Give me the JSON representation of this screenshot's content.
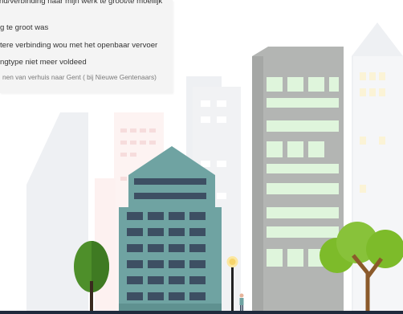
{
  "survey": {
    "options": [
      "nd/verbinding naar mijn werk te groot/te moeilijk",
      "g te groot was",
      "tere verbinding wou met het openbaar vervoer",
      "ngtype niet meer voldeed"
    ],
    "subtext": "nen van verhuis naar Gent ( bij Nieuwe Gentenaars)"
  },
  "colors": {
    "teal_building": "#6fa3a2",
    "gray_building": "#b3b5b3",
    "window_green": "#dff5dc",
    "bar": "#1f2a3c"
  }
}
